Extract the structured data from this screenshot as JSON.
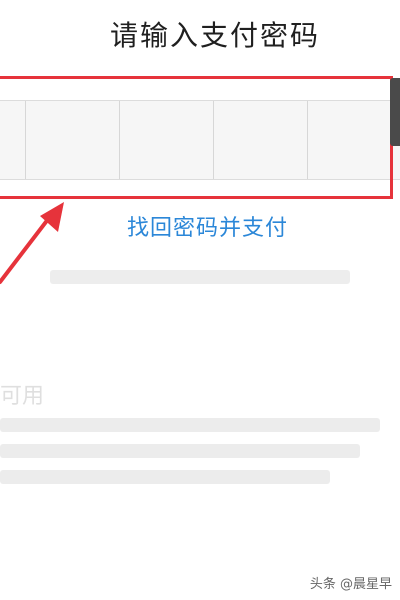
{
  "dialog": {
    "title": "请输入支付密码",
    "password_cells": [
      "",
      "",
      "",
      "",
      ""
    ],
    "recover_link": "找回密码并支付"
  },
  "background": {
    "heading_fragment": "可用"
  },
  "watermark": {
    "text": "头条 @晨星早"
  },
  "colors": {
    "accent_red": "#e6333b",
    "link_blue": "#2b87d8"
  },
  "icons": {
    "annotation_arrow": "red-arrow-icon"
  }
}
